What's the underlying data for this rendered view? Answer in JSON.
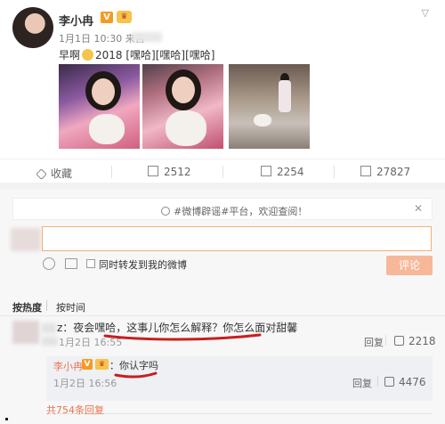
{
  "post": {
    "author": "李小冉",
    "v_badge": "V",
    "crown_badge": "",
    "dropdown_icon": "chevron-down-icon",
    "meta": "1月1日 10:30 来自",
    "text_pre": "早啊",
    "text_post": "2018 [嘿哈][嘿哈][嘿哈]"
  },
  "actions": {
    "favorite": "收藏",
    "repost": "2512",
    "comment": "2254",
    "like": "27827"
  },
  "notice": {
    "text": "#微博辟谣#平台，欢迎查阅！",
    "close": "✕"
  },
  "composer": {
    "sync_label": "同时转发到我的微博",
    "submit": "评论"
  },
  "tabs": {
    "hot": "按热度",
    "time": "按时间"
  },
  "comment": {
    "text": "z：夜会嘿哈，这事儿你怎么解释？你怎么面对甜馨",
    "date": "1月2日 16:55",
    "reply": "回复",
    "likes": "2218"
  },
  "sub_reply": {
    "author": "李小冉",
    "v_badge": "V",
    "text": "：你认字吗",
    "date": "1月2日 16:56",
    "reply": "回复",
    "likes": "4476"
  },
  "total_replies": "共754条回复",
  "colors": {
    "accent": "#eb7350",
    "input_border": "#f0b17a",
    "submit_bg": "#f7b89a",
    "v_badge": "#f59a23"
  }
}
